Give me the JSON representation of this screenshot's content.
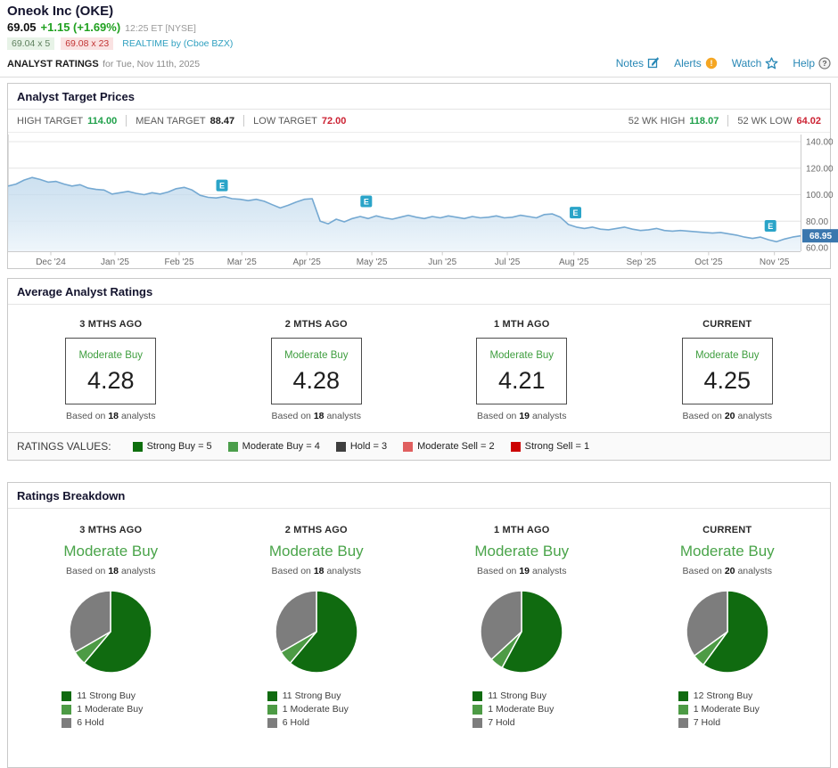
{
  "colors": {
    "accent_green": "#21a121",
    "accent_red": "#cc2233",
    "link_blue": "#2787b5",
    "realtime_teal": "#2fa0c0",
    "alert_orange": "#f5a623"
  },
  "header": {
    "company": "Oneok Inc (OKE)",
    "price": "69.05",
    "change": "+1.15 (+1.69%)",
    "time": "12:25 ET [NYSE]",
    "bid": "69.04 x 5",
    "ask": "69.08 x 23",
    "realtime": "REALTIME by (Cboe BZX)",
    "page_label": "ANALYST RATINGS",
    "page_date": "for Tue, Nov 11th, 2025",
    "links": {
      "notes": "Notes",
      "alerts": "Alerts",
      "watch": "Watch",
      "help": "Help"
    },
    "icons": {
      "notes": "note-compose-icon",
      "alerts": "alert-exclamation-icon",
      "watch": "star-outline-icon",
      "help": "question-circle-icon"
    }
  },
  "target_prices": {
    "title": "Analyst Target Prices",
    "high_label": "HIGH TARGET",
    "high_value": "114.00",
    "mean_label": "MEAN TARGET",
    "mean_value": "88.47",
    "low_label": "LOW TARGET",
    "low_value": "72.00",
    "wk_high_label": "52 WK HIGH",
    "wk_high_value": "118.07",
    "wk_low_label": "52 WK LOW",
    "wk_low_value": "64.02"
  },
  "chart_data": [
    {
      "id": "price_history",
      "type": "area",
      "title": "OKE price history with analyst targets, Nov 2024 - Nov 2025",
      "ylim": [
        57,
        143
      ],
      "grid": true,
      "y_axis_side": "right",
      "y_ticks": [
        "140.00",
        "120.00",
        "100.00",
        "80.00",
        "60.00"
      ],
      "x_labels": [
        {
          "label": "Dec '24",
          "x": 0.054
        },
        {
          "label": "Jan '25",
          "x": 0.135
        },
        {
          "label": "Feb '25",
          "x": 0.216
        },
        {
          "label": "Mar '25",
          "x": 0.295
        },
        {
          "label": "Apr '25",
          "x": 0.377
        },
        {
          "label": "May '25",
          "x": 0.459
        },
        {
          "label": "Jun '25",
          "x": 0.548
        },
        {
          "label": "Jul '25",
          "x": 0.63
        },
        {
          "label": "Aug '25",
          "x": 0.714
        },
        {
          "label": "Sep '25",
          "x": 0.799
        },
        {
          "label": "Oct '25",
          "x": 0.884
        },
        {
          "label": "Nov '25",
          "x": 0.967
        }
      ],
      "values": [
        106.5,
        108,
        111,
        113,
        111.5,
        109.5,
        110,
        108,
        106.5,
        107.5,
        105,
        104,
        103.5,
        100.5,
        101.5,
        102.5,
        101,
        100,
        101.5,
        100.5,
        102,
        104.5,
        105.5,
        103.5,
        99.5,
        98,
        97.5,
        98.5,
        97,
        96.5,
        95.5,
        96.5,
        95,
        92.5,
        90,
        92,
        94.5,
        96.5,
        97,
        80,
        78,
        81.5,
        79.5,
        82,
        83.5,
        82,
        84,
        82.5,
        81.5,
        83,
        84.5,
        83,
        82,
        83.5,
        82.5,
        84,
        83,
        82,
        83.5,
        82.5,
        83,
        84,
        82.5,
        83,
        84.5,
        83.5,
        82.5,
        85,
        85.5,
        83,
        77.5,
        75.5,
        74.5,
        75.5,
        74,
        73.5,
        74.5,
        75.5,
        74,
        73,
        73.5,
        74.5,
        73,
        72.5,
        73,
        72.5,
        72,
        71.5,
        71,
        71.5,
        70.5,
        69.5,
        68,
        67,
        68,
        66,
        64.5,
        66.5,
        68,
        68.95
      ],
      "current_price": "68.95",
      "marker_label": "E",
      "earnings_markers": [
        {
          "x": 0.27,
          "v": 107
        },
        {
          "x": 0.452,
          "v": 95
        },
        {
          "x": 0.716,
          "v": 86.5
        },
        {
          "x": 0.962,
          "v": 76.5
        }
      ],
      "colors": {
        "line": "#75a9d2",
        "grid": "#e4e4e4",
        "axis_text": "#6b6b6b",
        "marker": "#2aa4c8",
        "badge": "#3b77ae"
      }
    },
    {
      "id": "pie_3mo",
      "type": "pie",
      "period": "3 MTHS AGO",
      "slices": [
        {
          "label": "11 Strong Buy",
          "value": 11,
          "color": "#106b10"
        },
        {
          "label": "1 Moderate Buy",
          "value": 1,
          "color": "#4d9b45"
        },
        {
          "label": "6 Hold",
          "value": 6,
          "color": "#7d7d7d"
        }
      ]
    },
    {
      "id": "pie_2mo",
      "type": "pie",
      "period": "2 MTHS AGO",
      "slices": [
        {
          "label": "11 Strong Buy",
          "value": 11,
          "color": "#106b10"
        },
        {
          "label": "1 Moderate Buy",
          "value": 1,
          "color": "#4d9b45"
        },
        {
          "label": "6 Hold",
          "value": 6,
          "color": "#7d7d7d"
        }
      ]
    },
    {
      "id": "pie_1mo",
      "type": "pie",
      "period": "1 MTH AGO",
      "slices": [
        {
          "label": "11 Strong Buy",
          "value": 11,
          "color": "#106b10"
        },
        {
          "label": "1 Moderate Buy",
          "value": 1,
          "color": "#4d9b45"
        },
        {
          "label": "7 Hold",
          "value": 7,
          "color": "#7d7d7d"
        }
      ]
    },
    {
      "id": "pie_current",
      "type": "pie",
      "period": "CURRENT",
      "slices": [
        {
          "label": "12 Strong Buy",
          "value": 12,
          "color": "#106b10"
        },
        {
          "label": "1 Moderate Buy",
          "value": 1,
          "color": "#4d9b45"
        },
        {
          "label": "7 Hold",
          "value": 7,
          "color": "#7d7d7d"
        }
      ]
    }
  ],
  "avg_ratings": {
    "title": "Average Analyst Ratings",
    "based_prefix": "Based on",
    "analysts_suffix": "analysts",
    "columns": [
      {
        "period": "3 MTHS AGO",
        "rating": "Moderate Buy",
        "value": "4.28",
        "count": "18"
      },
      {
        "period": "2 MTHS AGO",
        "rating": "Moderate Buy",
        "value": "4.28",
        "count": "18"
      },
      {
        "period": "1 MTH AGO",
        "rating": "Moderate Buy",
        "value": "4.21",
        "count": "19"
      },
      {
        "period": "CURRENT",
        "rating": "Moderate Buy",
        "value": "4.25",
        "count": "20"
      }
    ],
    "legend_title": "RATINGS VALUES:",
    "legend": [
      {
        "label": "Strong Buy = 5",
        "color": "#0d6e0d"
      },
      {
        "label": "Moderate Buy = 4",
        "color": "#4b9e4b"
      },
      {
        "label": "Hold = 3",
        "color": "#3f3f3f"
      },
      {
        "label": "Moderate Sell = 2",
        "color": "#e05f5f"
      },
      {
        "label": "Strong Sell = 1",
        "color": "#cc0000"
      }
    ]
  },
  "breakdown": {
    "title": "Ratings Breakdown",
    "based_prefix": "Based on",
    "analysts_suffix": "analysts",
    "columns": [
      {
        "period": "3 MTHS AGO",
        "rating": "Moderate Buy",
        "count": "18"
      },
      {
        "period": "2 MTHS AGO",
        "rating": "Moderate Buy",
        "count": "18"
      },
      {
        "period": "1 MTH AGO",
        "rating": "Moderate Buy",
        "count": "19"
      },
      {
        "period": "CURRENT",
        "rating": "Moderate Buy",
        "count": "20"
      }
    ]
  }
}
